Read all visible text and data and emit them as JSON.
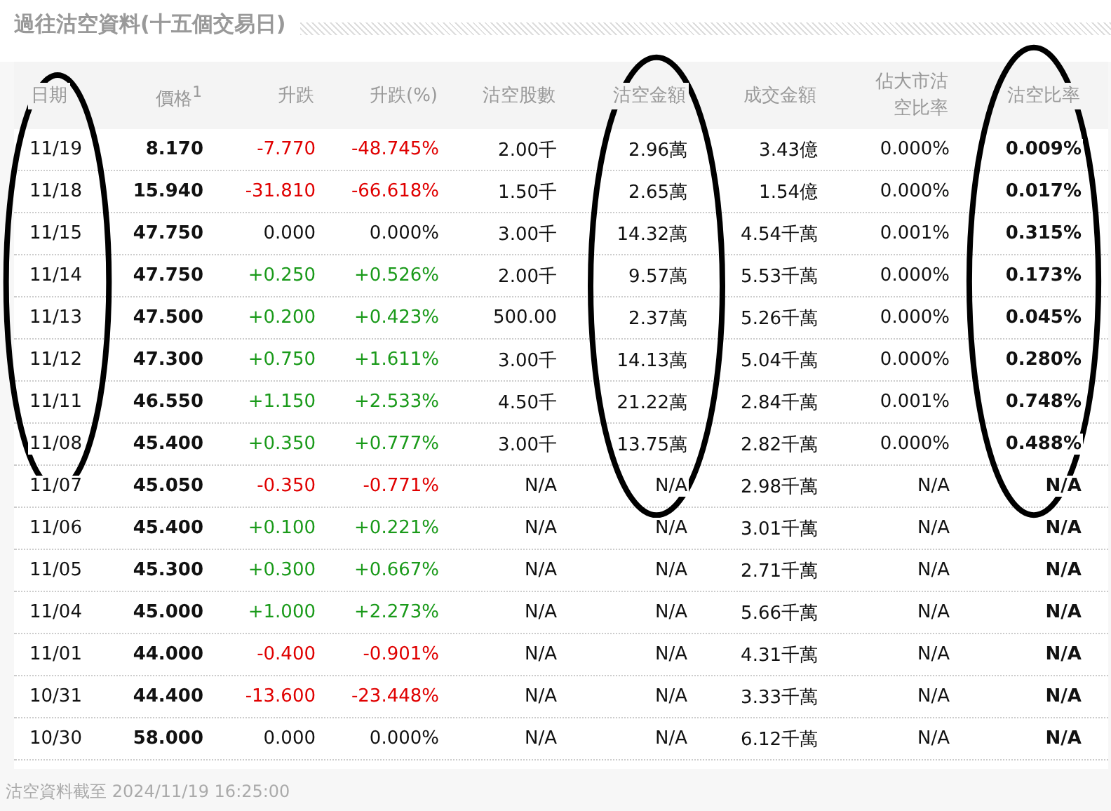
{
  "title": "過往沽空資料(十五個交易日)",
  "columns": [
    {
      "label": "日期",
      "circled": true
    },
    {
      "label": "價格$^{1}$",
      "circled": false
    },
    {
      "label": "升跌",
      "circled": false
    },
    {
      "label": "升跌(%)",
      "circled": false
    },
    {
      "label": "沽空股數",
      "circled": false
    },
    {
      "label": "沽空金額",
      "circled": true
    },
    {
      "label": "成交金額",
      "circled": false
    },
    {
      "label": "佔大市沽空比率",
      "circled": false
    },
    {
      "label": "沽空比率",
      "circled": true
    }
  ],
  "rows": [
    {
      "color": "#e00000",
      "cells": [
        "11/19",
        "8.170",
        "-7.770",
        "-48.745%",
        "2.00千",
        "2.96萬",
        "3.43億",
        "0.000%",
        "0.009%"
      ]
    },
    {
      "color": "#e00000",
      "cells": [
        "11/18",
        "15.940",
        "-31.810",
        "-66.618%",
        "1.50千",
        "2.65萬",
        "1.54億",
        "0.000%",
        "0.017%"
      ]
    },
    {
      "color": "#111111",
      "cells": [
        "11/15",
        "47.750",
        "0.000",
        "0.000%",
        "3.00千",
        "14.32萬",
        "4.54千萬",
        "0.001%",
        "0.315%"
      ]
    },
    {
      "color": "#1a9a1a",
      "cells": [
        "11/14",
        "47.750",
        "+0.250",
        "+0.526%",
        "2.00千",
        "9.57萬",
        "5.53千萬",
        "0.000%",
        "0.173%"
      ]
    },
    {
      "color": "#1a9a1a",
      "cells": [
        "11/13",
        "47.500",
        "+0.200",
        "+0.423%",
        "500.00",
        "2.37萬",
        "5.26千萬",
        "0.000%",
        "0.045%"
      ]
    },
    {
      "color": "#1a9a1a",
      "cells": [
        "11/12",
        "47.300",
        "+0.750",
        "+1.611%",
        "3.00千",
        "14.13萬",
        "5.04千萬",
        "0.000%",
        "0.280%"
      ]
    },
    {
      "color": "#1a9a1a",
      "cells": [
        "11/11",
        "46.550",
        "+1.150",
        "+2.533%",
        "4.50千",
        "21.22萬",
        "2.84千萬",
        "0.001%",
        "0.748%"
      ]
    },
    {
      "color": "#1a9a1a",
      "cells": [
        "11/08",
        "45.400",
        "+0.350",
        "+0.777%",
        "3.00千",
        "13.75萬",
        "2.82千萬",
        "0.000%",
        "0.488%"
      ]
    },
    {
      "color": "#e00000",
      "cells": [
        "11/07",
        "45.050",
        "-0.350",
        "-0.771%",
        "N/A",
        "N/A",
        "2.98千萬",
        "N/A",
        "N/A"
      ]
    },
    {
      "color": "#1a9a1a",
      "cells": [
        "11/06",
        "45.400",
        "+0.100",
        "+0.221%",
        "N/A",
        "N/A",
        "3.01千萬",
        "N/A",
        "N/A"
      ]
    },
    {
      "color": "#1a9a1a",
      "cells": [
        "11/05",
        "45.300",
        "+0.300",
        "+0.667%",
        "N/A",
        "N/A",
        "2.71千萬",
        "N/A",
        "N/A"
      ]
    },
    {
      "color": "#1a9a1a",
      "cells": [
        "11/04",
        "45.000",
        "+1.000",
        "+2.273%",
        "N/A",
        "N/A",
        "5.66千萬",
        "N/A",
        "N/A"
      ]
    },
    {
      "color": "#e00000",
      "cells": [
        "11/01",
        "44.000",
        "-0.400",
        "-0.901%",
        "N/A",
        "N/A",
        "4.31千萬",
        "N/A",
        "N/A"
      ]
    },
    {
      "color": "#e00000",
      "cells": [
        "10/31",
        "44.400",
        "-13.600",
        "-23.448%",
        "N/A",
        "N/A",
        "3.33千萬",
        "N/A",
        "N/A"
      ]
    },
    {
      "color": "#111111",
      "cells": [
        "10/30",
        "58.000",
        "0.000",
        "0.000%",
        "N/A",
        "N/A",
        "6.12千萬",
        "N/A",
        "N/A"
      ]
    }
  ],
  "footer": "沽空資料截至 2024/11/19 16:25:00"
}
